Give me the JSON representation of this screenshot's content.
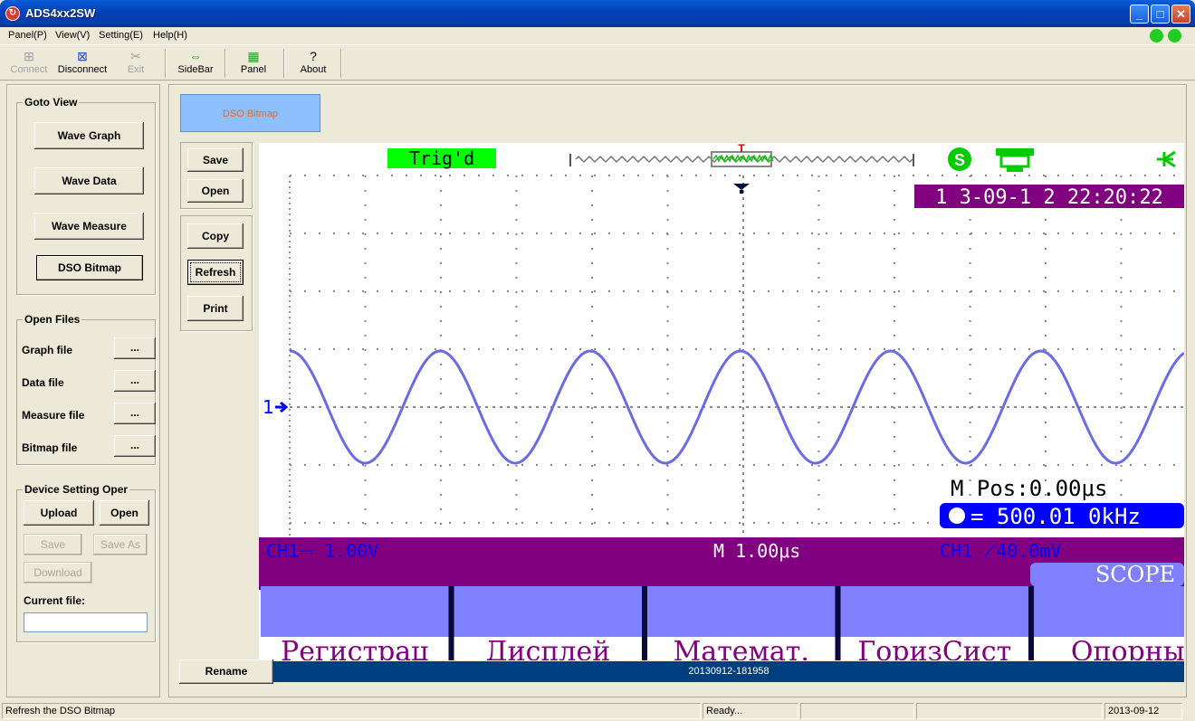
{
  "window": {
    "title": "ADS4xx2SW",
    "app_icon": "app-logo-icon"
  },
  "menu": {
    "items": [
      "Panel(P)",
      "View(V)",
      "Setting(E)",
      "Help(H)"
    ]
  },
  "toolbar": {
    "connect": "Connect",
    "disconnect": "Disconnect",
    "exit": "Exit",
    "sidebar": "SideBar",
    "panel": "Panel",
    "about": "About"
  },
  "sidebar": {
    "goto_view": {
      "legend": "Goto View",
      "wave_graph": "Wave Graph",
      "wave_data": "Wave Data",
      "wave_measure": "Wave Measure",
      "dso_bitmap": "DSO Bitmap"
    },
    "open_files": {
      "legend": "Open Files",
      "graph_file": "Graph file",
      "data_file": "Data file",
      "measure_file": "Measure file",
      "bitmap_file": "Bitmap file",
      "browse": "..."
    },
    "device_setting": {
      "legend": "Device Setting Oper",
      "upload": "Upload",
      "open": "Open",
      "save": "Save",
      "save_as": "Save As",
      "download": "Download",
      "current_file_label": "Current file:",
      "current_file_value": ""
    }
  },
  "main": {
    "tab_label": "DSO Bitmap",
    "buttons": {
      "save": "Save",
      "open": "Open",
      "copy": "Copy",
      "refresh": "Refresh",
      "print": "Print",
      "rename": "Rename"
    },
    "filename": "20130912-181958"
  },
  "scope": {
    "trig_status": "Trig'd",
    "datetime": "1 3-09-1 2 22:20:22",
    "m_pos": "M Pos:0.00μs",
    "frequency": "= 500.01 0kHz",
    "ch1_scale": "CH1⎓ 1.00V",
    "timebase": "M 1.00μs",
    "trigger": "CH1 ⟋40.0mV",
    "mode": "SCOPE",
    "channel_marker": "1",
    "menu_labels": [
      "Регистрац",
      "Дисплей",
      "Математ.",
      "ГоризСист",
      "Опорны"
    ],
    "colors": {
      "trace": "#6b6be6",
      "info_bar": "#80007f",
      "menu_bg": "#8080ff",
      "trig_green": "#00ff00",
      "datetime_bg": "#80007f",
      "freq_bg": "#0000ff"
    }
  },
  "statusbar": {
    "message": "Refresh the DSO Bitmap",
    "state": "Ready...",
    "date": "2013-09-12"
  }
}
